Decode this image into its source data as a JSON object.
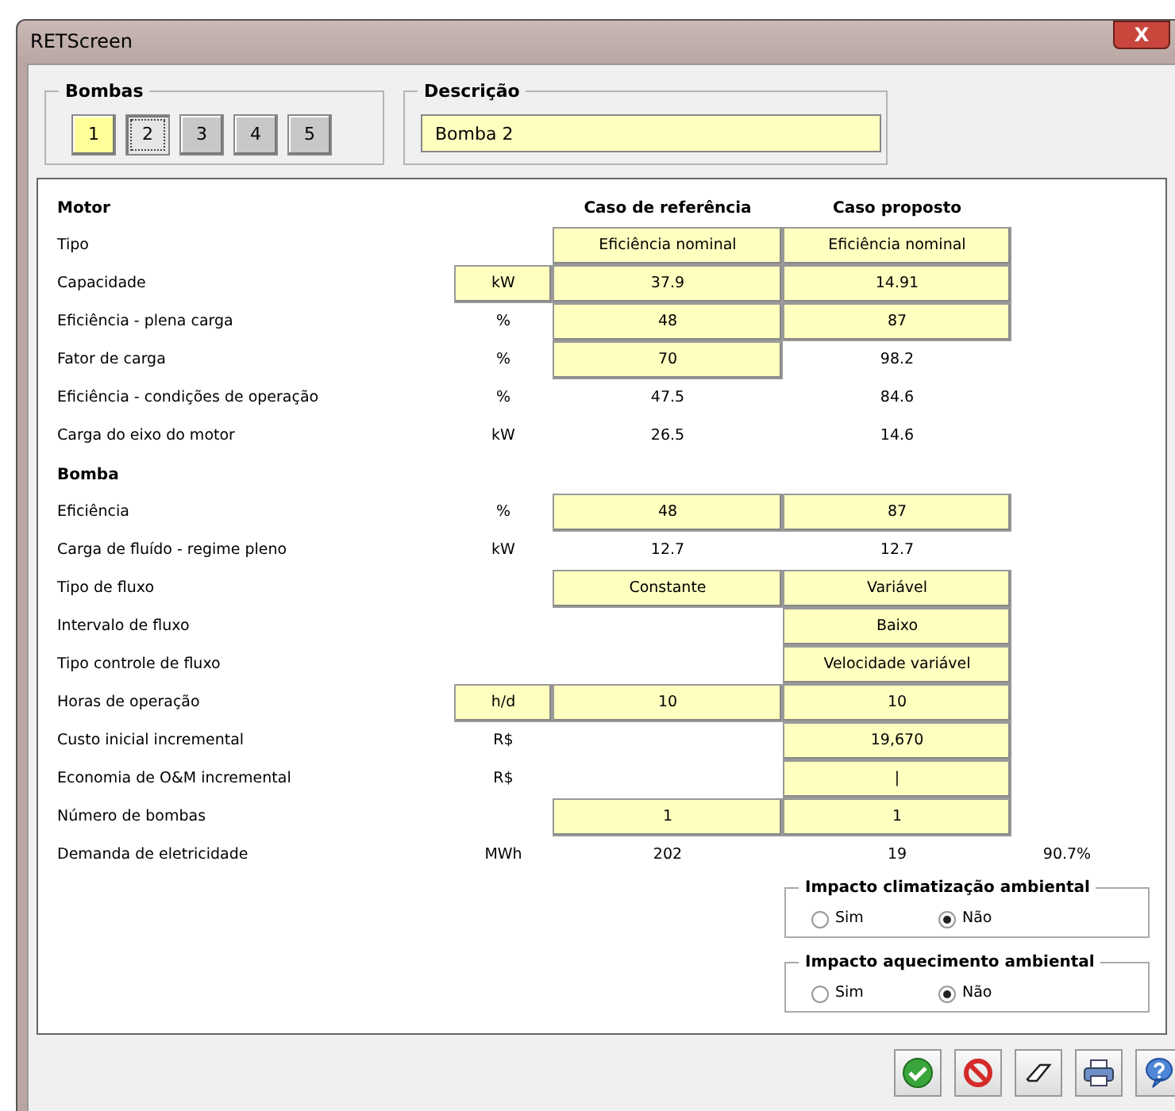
{
  "window": {
    "title": "RETScreen",
    "close_label": "X"
  },
  "pumps_group": {
    "title": "Bombas",
    "buttons": [
      {
        "label": "1",
        "highlighted": true,
        "selected": false
      },
      {
        "label": "2",
        "highlighted": false,
        "selected": true
      },
      {
        "label": "3",
        "highlighted": false,
        "selected": false
      },
      {
        "label": "4",
        "highlighted": false,
        "selected": false
      },
      {
        "label": "5",
        "highlighted": false,
        "selected": false
      }
    ]
  },
  "description_group": {
    "title": "Descrição",
    "value": "Bomba 2"
  },
  "table": {
    "columns": [
      "Caso de referência",
      "Caso proposto"
    ],
    "rows": [
      {
        "kind": "section",
        "label": "Motor",
        "show_columns": true
      },
      {
        "kind": "row",
        "label": "Tipo",
        "ref": {
          "text": "Eficiência nominal",
          "input": true
        },
        "prop": {
          "text": "Eficiência nominal",
          "input": true
        }
      },
      {
        "kind": "row",
        "label": "Capacidade",
        "unit": {
          "text": "kW",
          "input": true
        },
        "ref": {
          "text": "37.9",
          "input": true
        },
        "prop": {
          "text": "14.91",
          "input": true
        }
      },
      {
        "kind": "row",
        "label": "Eficiência - plena carga",
        "unit": {
          "text": "%",
          "input": false
        },
        "ref": {
          "text": "48",
          "input": true
        },
        "prop": {
          "text": "87",
          "input": true
        }
      },
      {
        "kind": "row",
        "label": "Fator de carga",
        "unit": {
          "text": "%",
          "input": false
        },
        "ref": {
          "text": "70",
          "input": true
        },
        "prop": {
          "text": "98.2",
          "input": false
        }
      },
      {
        "kind": "row",
        "label": "Eficiência - condições de operação",
        "unit": {
          "text": "%",
          "input": false
        },
        "ref": {
          "text": "47.5",
          "input": false
        },
        "prop": {
          "text": "84.6",
          "input": false
        }
      },
      {
        "kind": "row",
        "label": "Carga do eixo do motor",
        "unit": {
          "text": "kW",
          "input": false
        },
        "ref": {
          "text": "26.5",
          "input": false
        },
        "prop": {
          "text": "14.6",
          "input": false
        }
      },
      {
        "kind": "section",
        "label": "Bomba",
        "show_columns": false
      },
      {
        "kind": "row",
        "label": "Eficiência",
        "unit": {
          "text": "%",
          "input": false
        },
        "ref": {
          "text": "48",
          "input": true
        },
        "prop": {
          "text": "87",
          "input": true
        }
      },
      {
        "kind": "row",
        "label": "Carga de fluído - regime pleno",
        "unit": {
          "text": "kW",
          "input": false
        },
        "ref": {
          "text": "12.7",
          "input": false
        },
        "prop": {
          "text": "12.7",
          "input": false
        }
      },
      {
        "kind": "row",
        "label": "Tipo de fluxo",
        "ref": {
          "text": "Constante",
          "input": true
        },
        "prop": {
          "text": "Variável",
          "input": true
        }
      },
      {
        "kind": "row",
        "label": "Intervalo de fluxo",
        "prop": {
          "text": "Baixo",
          "input": true
        }
      },
      {
        "kind": "row",
        "label": "Tipo controle de fluxo",
        "prop": {
          "text": "Velocidade variável",
          "input": true
        }
      },
      {
        "kind": "row",
        "label": "Horas de operação",
        "unit": {
          "text": "h/d",
          "input": true
        },
        "ref": {
          "text": "10",
          "input": true
        },
        "prop": {
          "text": "10",
          "input": true
        }
      },
      {
        "kind": "row",
        "label": "Custo inicial incremental",
        "unit": {
          "text": "R$",
          "input": false
        },
        "prop": {
          "text": "19,670",
          "input": true
        }
      },
      {
        "kind": "row",
        "label": "Economia de O&M incremental",
        "unit": {
          "text": "R$",
          "input": false
        },
        "prop": {
          "text": "|",
          "input": true
        }
      },
      {
        "kind": "row",
        "label": "Número de bombas",
        "ref": {
          "text": "1",
          "input": true
        },
        "prop": {
          "text": "1",
          "input": true
        }
      },
      {
        "kind": "row",
        "label": "Demanda de eletricidade",
        "unit": {
          "text": "MWh",
          "input": false
        },
        "ref": {
          "text": "202",
          "input": false
        },
        "prop": {
          "text": "19",
          "input": false
        },
        "extra": "90.7%"
      }
    ]
  },
  "impact_groups": [
    {
      "title": "Impacto climatização ambiental",
      "options": [
        {
          "label": "Sim",
          "selected": false
        },
        {
          "label": "Não",
          "selected": true
        }
      ]
    },
    {
      "title": "Impacto aquecimento ambiental",
      "options": [
        {
          "label": "Sim",
          "selected": false
        },
        {
          "label": "Não",
          "selected": true
        }
      ]
    }
  ],
  "footer_buttons": [
    {
      "kind": "ok"
    },
    {
      "kind": "cancel"
    },
    {
      "kind": "erase"
    },
    {
      "kind": "print"
    },
    {
      "kind": "help"
    }
  ]
}
